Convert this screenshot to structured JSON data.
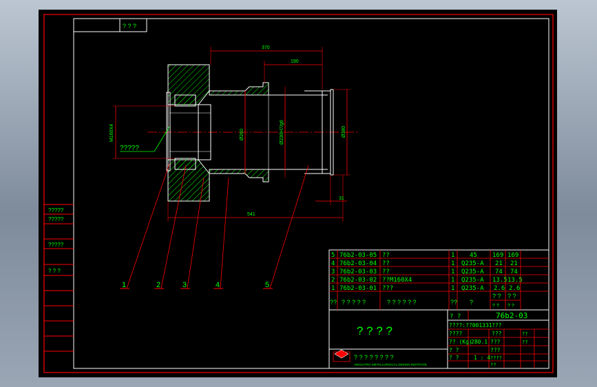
{
  "corner_box": "? ? ?",
  "dimensions": {
    "d370": "370",
    "d190": "190",
    "d541": "541",
    "d31": "31",
    "thread": "M160X4",
    "dia_a": "Ø260",
    "dia_b": "Ø230H7/g6",
    "dia_c": "Ø380",
    "note": "?????"
  },
  "balloons": [
    "1",
    "2",
    "3",
    "4",
    "5"
  ],
  "left_strip": [
    "?????",
    "?????",
    "?????",
    "? ? ?"
  ],
  "bom": {
    "rows": [
      {
        "no": "5",
        "code": "76b2-03-05",
        "name": "??",
        "qty": "1",
        "mat": "45",
        "w1": "169",
        "w2": "169"
      },
      {
        "no": "4",
        "code": "76b2-03-04",
        "name": "??",
        "qty": "1",
        "mat": "Q235-A",
        "w1": "21",
        "w2": "21"
      },
      {
        "no": "3",
        "code": "76b2-03-03",
        "name": "??",
        "qty": "1",
        "mat": "Q235-A",
        "w1": "74",
        "w2": "74"
      },
      {
        "no": "2",
        "code": "76b2-03-02",
        "name": "??M160X4",
        "qty": "1",
        "mat": "Q235-A",
        "w1": "13.5",
        "w2": "13.5"
      },
      {
        "no": "1",
        "code": "76b2-03-01",
        "name": "???",
        "qty": "1",
        "mat": "Q235-A",
        "w1": "2.6",
        "w2": "2.6"
      }
    ],
    "header": {
      "no": "??",
      "code": "? ? ? ? ?",
      "name": "? ? ? ? ? ?",
      "qty": "??",
      "mat": "?",
      "w1": "? ?",
      "w2": "? ?",
      "w3": "? ?",
      "w4": "? ?"
    }
  },
  "title_block": {
    "drawing_title": "? ? ? ?",
    "drawing_no_label": "?   ?",
    "drawing_no": "76b2-03",
    "asm_no": "????:??001331",
    "r1": "????",
    "weight_label": "?? (Kg)",
    "weight": "280.1",
    "scale_label": "?   ?",
    "scale": "1 : 4",
    "sheet_label": "?   ?",
    "company_logo_text": "ANHUI PRC METALLURGICAL DESIGN INSTITUTE",
    "company_cn": "? ? ? ? ? ? ? ?",
    "right_a": "???",
    "right_b": "???",
    "right_c": "???",
    "right_d": "???",
    "right_e": "??",
    "right_f": "????",
    "right_g": "??",
    "right_h": "??"
  },
  "colors": {
    "frame": "#ff0000",
    "border": "#ffffff",
    "text": "#00ff00",
    "hatch": "#00ff00",
    "tableline": "#ff0000",
    "dim": "#ff0000"
  }
}
